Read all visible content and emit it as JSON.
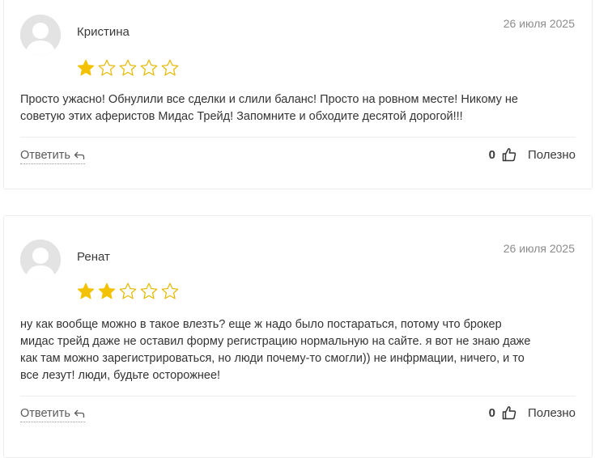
{
  "colors": {
    "star_filled": "#f2c200",
    "star_empty_stroke": "#e6b800"
  },
  "reviews": [
    {
      "author": "Кристина",
      "date": "26 июля 2025",
      "rating": 1,
      "max_rating": 5,
      "text": "Просто ужасно! Обнулили все сделки и слили баланс! Просто на ровном месте! Никому не\nсоветую этих аферистов Мидас Трейд! Запомните и обходите десятой дорогой!!!",
      "reply_label": "Ответить",
      "helpful_count": "0",
      "helpful_label": "Полезно"
    },
    {
      "author": "Ренат",
      "date": "26 июля 2025",
      "rating": 2,
      "max_rating": 5,
      "text": "ну как вообще можно в такое влезть? еще ж надо было постараться, потому что брокер\nмидас трейд даже не оставил форму регистрацию нормальную на сайте. я вот не знаю даже\nкак там можно зарегистрироваться, но люди почему-то смогли)) не инфрмации, ничего, и то\nвсе лезут! люди, будьте осторожнее!",
      "reply_label": "Ответить",
      "helpful_count": "0",
      "helpful_label": "Полезно"
    }
  ]
}
